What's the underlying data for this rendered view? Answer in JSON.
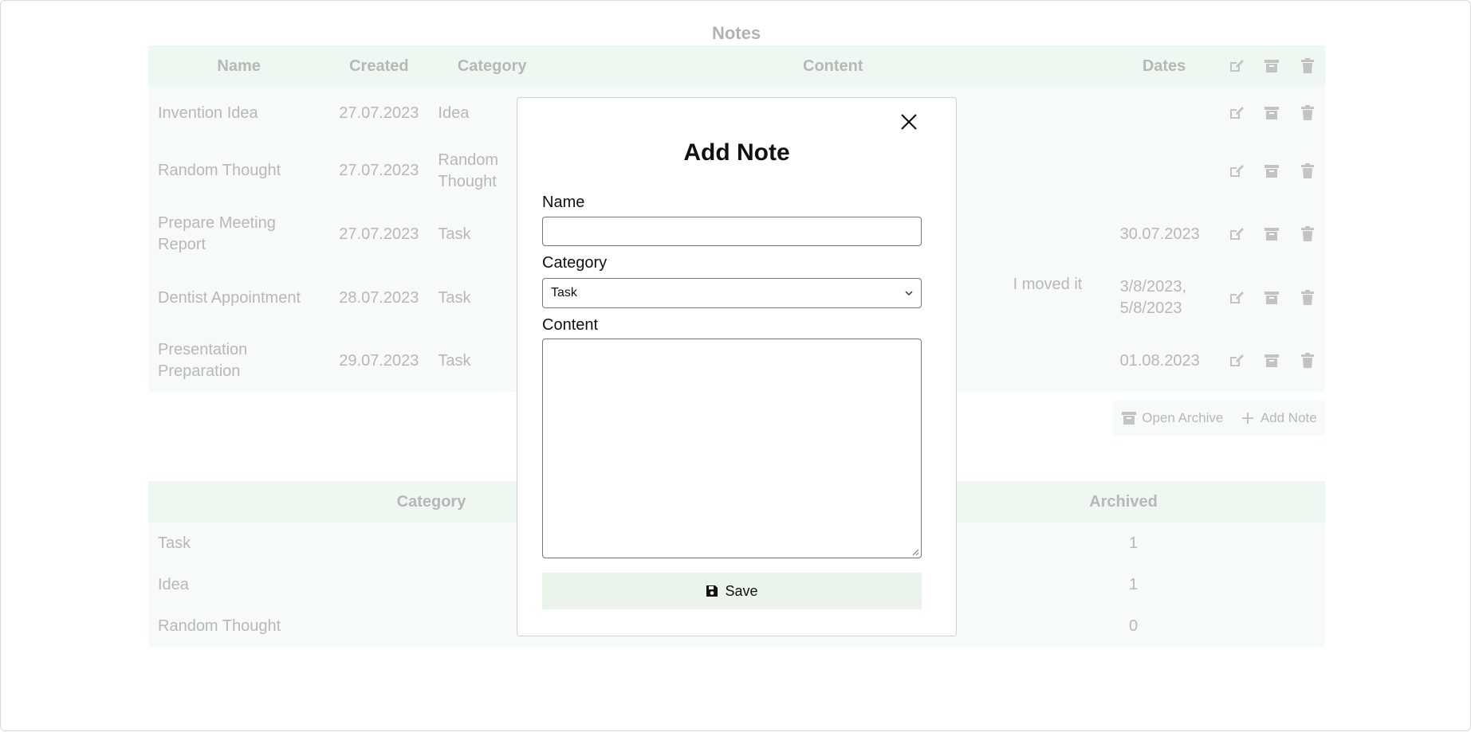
{
  "page": {
    "title": "Notes"
  },
  "notes_table": {
    "headers": [
      "Name",
      "Created",
      "Category",
      "Content",
      "Dates"
    ],
    "rows": [
      {
        "name": "Invention Idea",
        "created": "27.07.2023",
        "category": "Idea",
        "content": "",
        "dates": ""
      },
      {
        "name": "Random Thought",
        "created": "27.07.2023",
        "category": "Random Thought",
        "content": "",
        "dates": ""
      },
      {
        "name": "Prepare Meeting Report",
        "created": "27.07.2023",
        "category": "Task",
        "content": "",
        "dates": "30.07.2023"
      },
      {
        "name": "Dentist Appointment",
        "created": "28.07.2023",
        "category": "Task",
        "content": "I moved it",
        "dates": "3/8/2023, 5/8/2023"
      },
      {
        "name": "Presentation Preparation",
        "created": "29.07.2023",
        "category": "Task",
        "content": "",
        "dates": "01.08.2023"
      }
    ]
  },
  "actions": {
    "open_archive": "Open Archive",
    "add_note": "Add Note"
  },
  "stats_table": {
    "headers": [
      "Category",
      "Archived"
    ],
    "rows": [
      {
        "category": "Task",
        "archived": "1"
      },
      {
        "category": "Idea",
        "archived": "1"
      },
      {
        "category": "Random Thought",
        "archived": "0"
      }
    ]
  },
  "modal": {
    "title": "Add Note",
    "name_label": "Name",
    "name_value": "",
    "category_label": "Category",
    "category_value": "Task",
    "content_label": "Content",
    "content_value": "",
    "save_label": "Save"
  },
  "colors": {
    "header_bg": "#d2ecd5",
    "row_bg": "#eaf4ea",
    "save_bg": "#eaf4ea"
  }
}
